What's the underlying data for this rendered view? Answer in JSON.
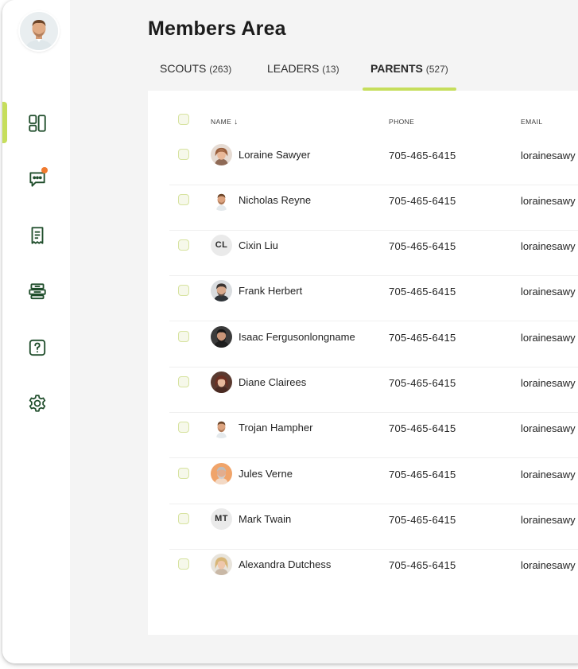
{
  "page": {
    "title": "Members Area"
  },
  "tabs": [
    {
      "label": "SCOUTS",
      "count": "(263)"
    },
    {
      "label": "LEADERS",
      "count": "(13)"
    },
    {
      "label": "PARENTS",
      "count": "(527)",
      "active": true
    }
  ],
  "sidebar": {
    "accent_color": "#c6de5c",
    "icon_color": "#1f4d2b",
    "notification_color": "#f07a2e",
    "items": [
      {
        "icon": "dashboard-icon",
        "active": true
      },
      {
        "icon": "chat-icon",
        "has_notification": true
      },
      {
        "icon": "receipt-icon"
      },
      {
        "icon": "inventory-icon"
      },
      {
        "icon": "help-icon"
      },
      {
        "icon": "settings-icon"
      }
    ]
  },
  "table": {
    "columns": [
      {
        "key": "name",
        "label": "NAME",
        "sort": "desc-arrow"
      },
      {
        "key": "phone",
        "label": "PHONE"
      },
      {
        "key": "email",
        "label": "EMAIL"
      }
    ],
    "rows": [
      {
        "name": "Loraine Sawyer",
        "phone": "705-465-6415",
        "email": "lorainesawy",
        "avatar": "photo"
      },
      {
        "name": "Nicholas Reyne",
        "phone": "705-465-6415",
        "email": "lorainesawy",
        "avatar": "photo"
      },
      {
        "name": "Cixin Liu",
        "phone": "705-465-6415",
        "email": "lorainesawy",
        "avatar": "initials",
        "initials": "CL"
      },
      {
        "name": "Frank Herbert",
        "phone": "705-465-6415",
        "email": "lorainesawy",
        "avatar": "photo"
      },
      {
        "name": "Isaac Fergusonlongname",
        "phone": "705-465-6415",
        "email": "lorainesawy",
        "avatar": "photo"
      },
      {
        "name": "Diane Clairees",
        "phone": "705-465-6415",
        "email": "lorainesawy",
        "avatar": "photo"
      },
      {
        "name": "Trojan Hampher",
        "phone": "705-465-6415",
        "email": "lorainesawy",
        "avatar": "photo"
      },
      {
        "name": "Jules Verne",
        "phone": "705-465-6415",
        "email": "lorainesawy",
        "avatar": "photo"
      },
      {
        "name": "Mark Twain",
        "phone": "705-465-6415",
        "email": "lorainesawy",
        "avatar": "initials",
        "initials": "MT"
      },
      {
        "name": "Alexandra Dutchess",
        "phone": "705-465-6415",
        "email": "lorainesawy",
        "avatar": "photo"
      }
    ]
  }
}
